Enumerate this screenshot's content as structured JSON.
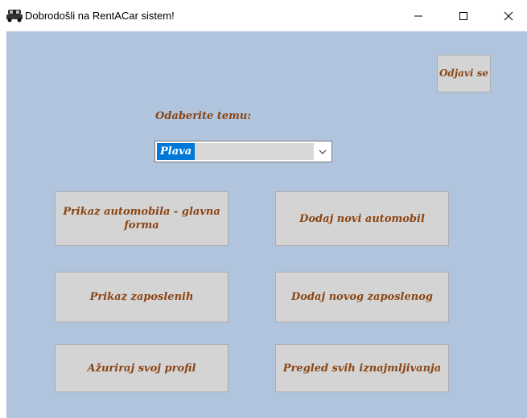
{
  "window": {
    "title": "Dobrodošli na RentACar sistem!",
    "icon": "car-icon",
    "controls": [
      "minimize-icon",
      "maximize-icon",
      "close-icon"
    ]
  },
  "logout": {
    "label": "Odjavi se"
  },
  "theme": {
    "label": "Odaberite temu:",
    "selected": "Plava"
  },
  "buttons": {
    "show_cars": "Prikaz automobila - glavna forma",
    "add_car": "Dodaj novi automobil",
    "show_employees": "Prikaz zaposlenih",
    "add_employee": "Dodaj novog zaposlenog",
    "update_profile": "Ažuriraj svoj profil",
    "rentals_overview": "Pregled svih iznajmljivanja"
  },
  "colors": {
    "background": "#b0c4de",
    "button": "#d4d4d4",
    "text": "#8b4513",
    "selection": "#0078d7"
  }
}
